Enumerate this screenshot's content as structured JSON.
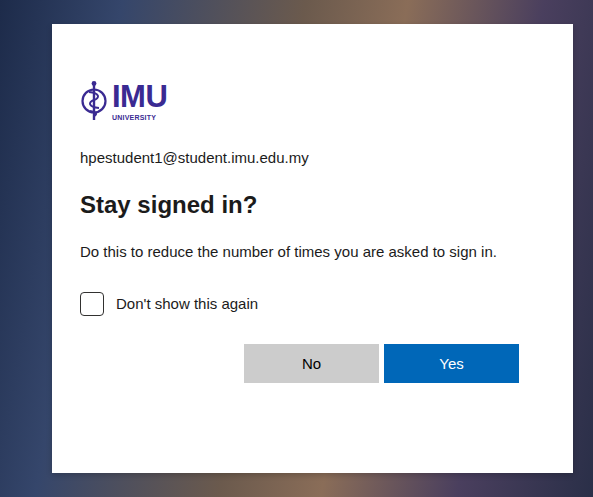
{
  "logo": {
    "name": "IMU",
    "subtitle": "UNIVERSITY"
  },
  "account": "hpestudent1@student.imu.edu.my",
  "title": "Stay signed in?",
  "description": "Do this to reduce the number of times you are asked to sign in.",
  "checkbox": {
    "label": "Don't show this again",
    "checked": false
  },
  "buttons": [
    {
      "label": "No",
      "kind": "secondary"
    },
    {
      "label": "Yes",
      "kind": "primary"
    }
  ]
}
